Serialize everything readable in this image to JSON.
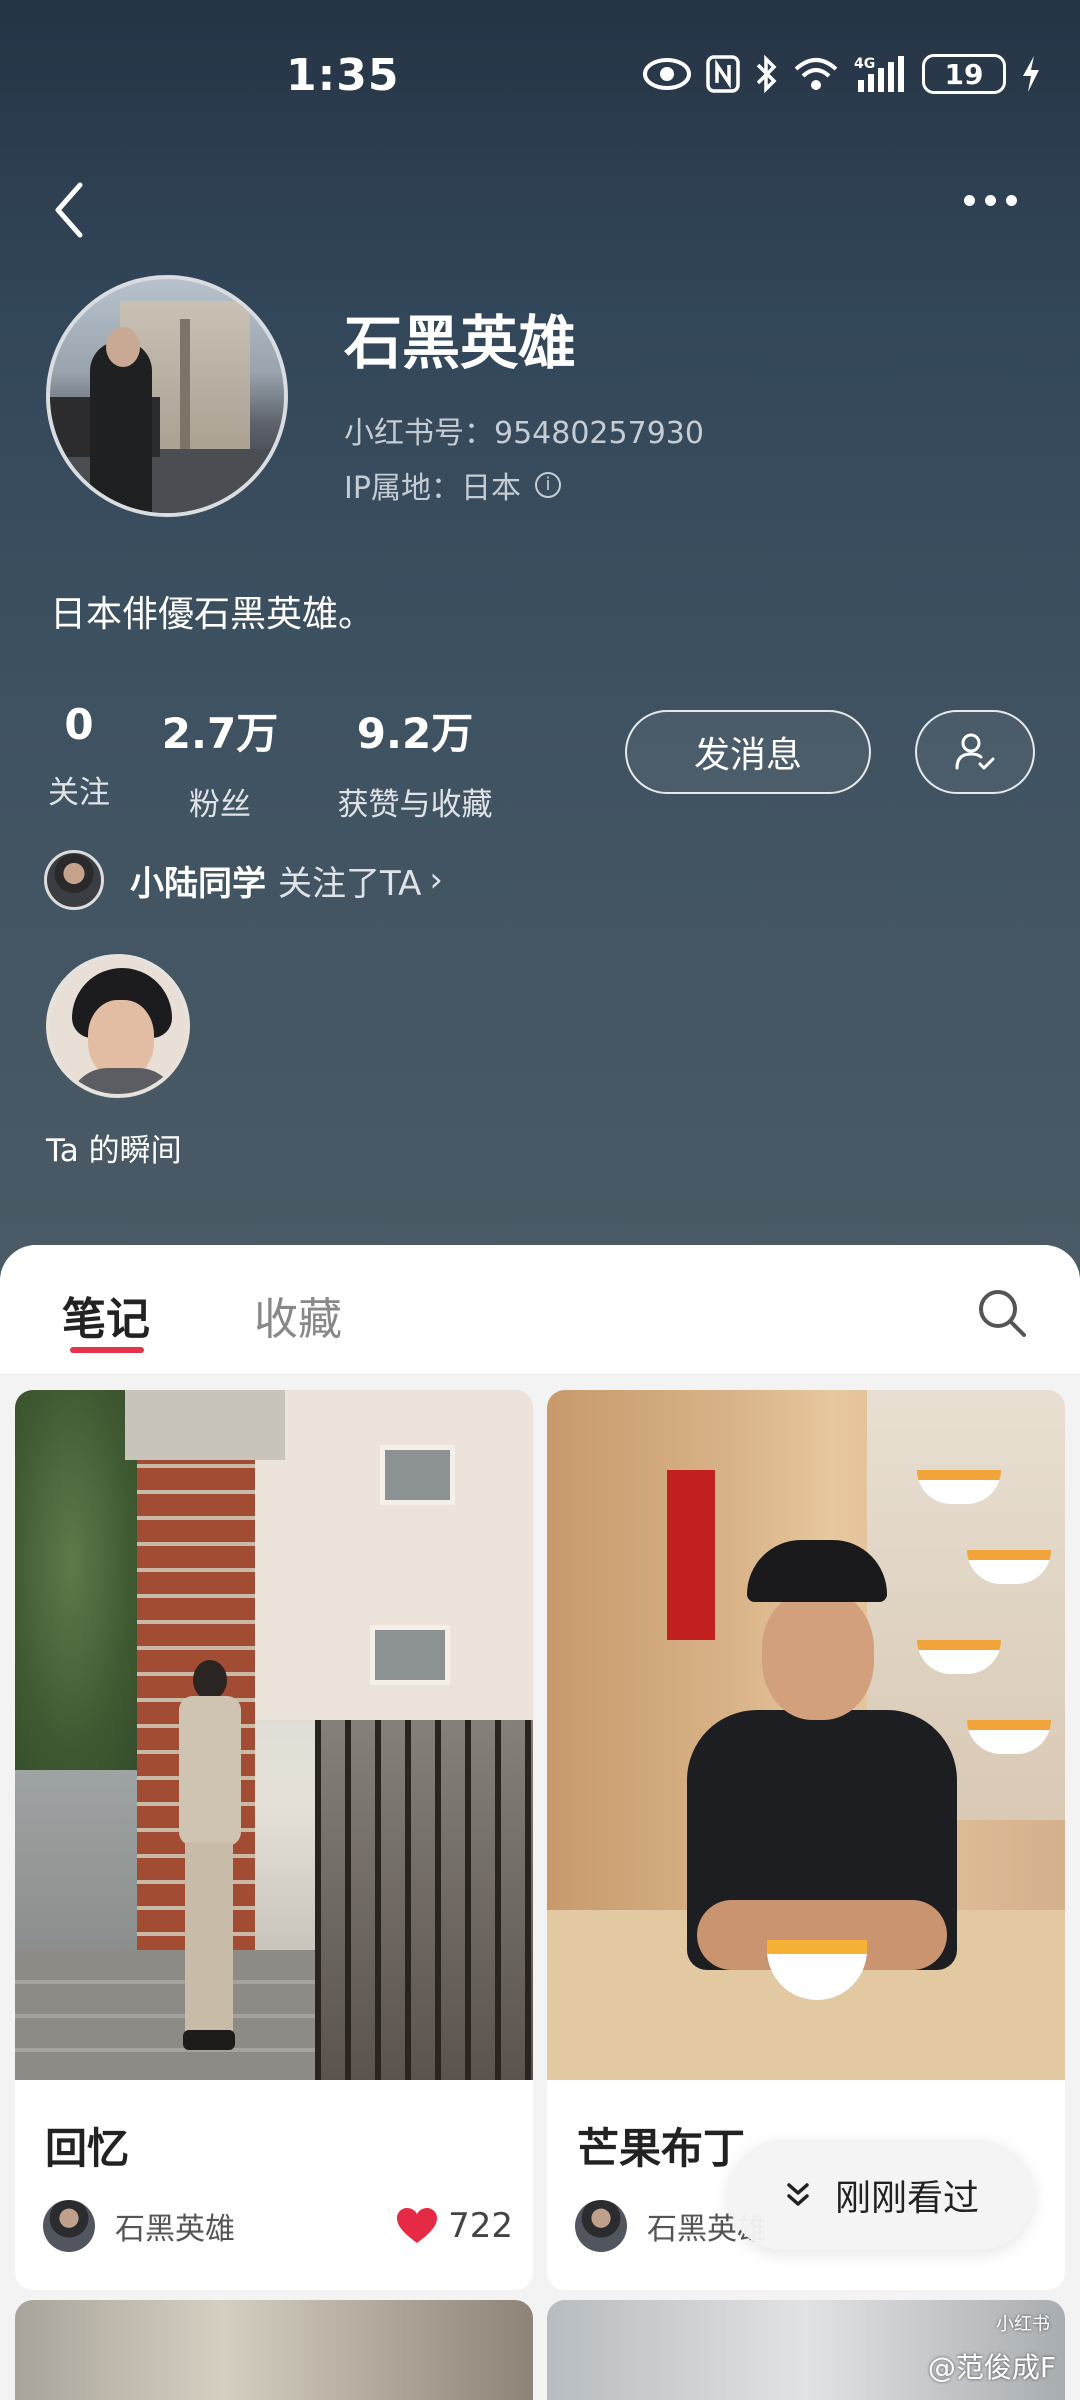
{
  "status_bar": {
    "time": "1:35",
    "network": "4G",
    "battery": "19"
  },
  "profile": {
    "name": "石黑英雄",
    "id_line": "小红书号：95480257930",
    "ip_line": "IP属地：日本",
    "bio": "日本俳優石黑英雄。"
  },
  "stats": [
    {
      "value": "0",
      "label": "关注"
    },
    {
      "value": "2.7万",
      "label": "粉丝"
    },
    {
      "value": "9.2万",
      "label": "获赞与收藏"
    }
  ],
  "buttons": {
    "message": "发消息"
  },
  "mutual": {
    "name": "小陆同学",
    "text": "关注了TA",
    "chevron": "›"
  },
  "moments": {
    "label": "Ta 的瞬间"
  },
  "tabs": {
    "notes": "笔记",
    "favorites": "收藏"
  },
  "cards": [
    {
      "title": "回忆",
      "author": "石黑英雄",
      "likes": "722"
    },
    {
      "title": "芒果布丁",
      "author": "石黑英雄"
    }
  ],
  "recent_pill": {
    "label": "刚刚看过"
  },
  "watermark": {
    "text": "@范俊成F",
    "small": "小红书"
  },
  "colors": {
    "accent": "#e5344a",
    "header_top": "#253445",
    "header_bottom": "#4b5b66"
  },
  "icons": [
    "back-icon",
    "more-icon",
    "eye-icon",
    "nfc-icon",
    "bluetooth-icon",
    "wifi-icon",
    "signal-icon",
    "charging-icon",
    "info-icon",
    "follow-user-icon",
    "search-icon",
    "heart-icon",
    "chevron-down-icon"
  ]
}
